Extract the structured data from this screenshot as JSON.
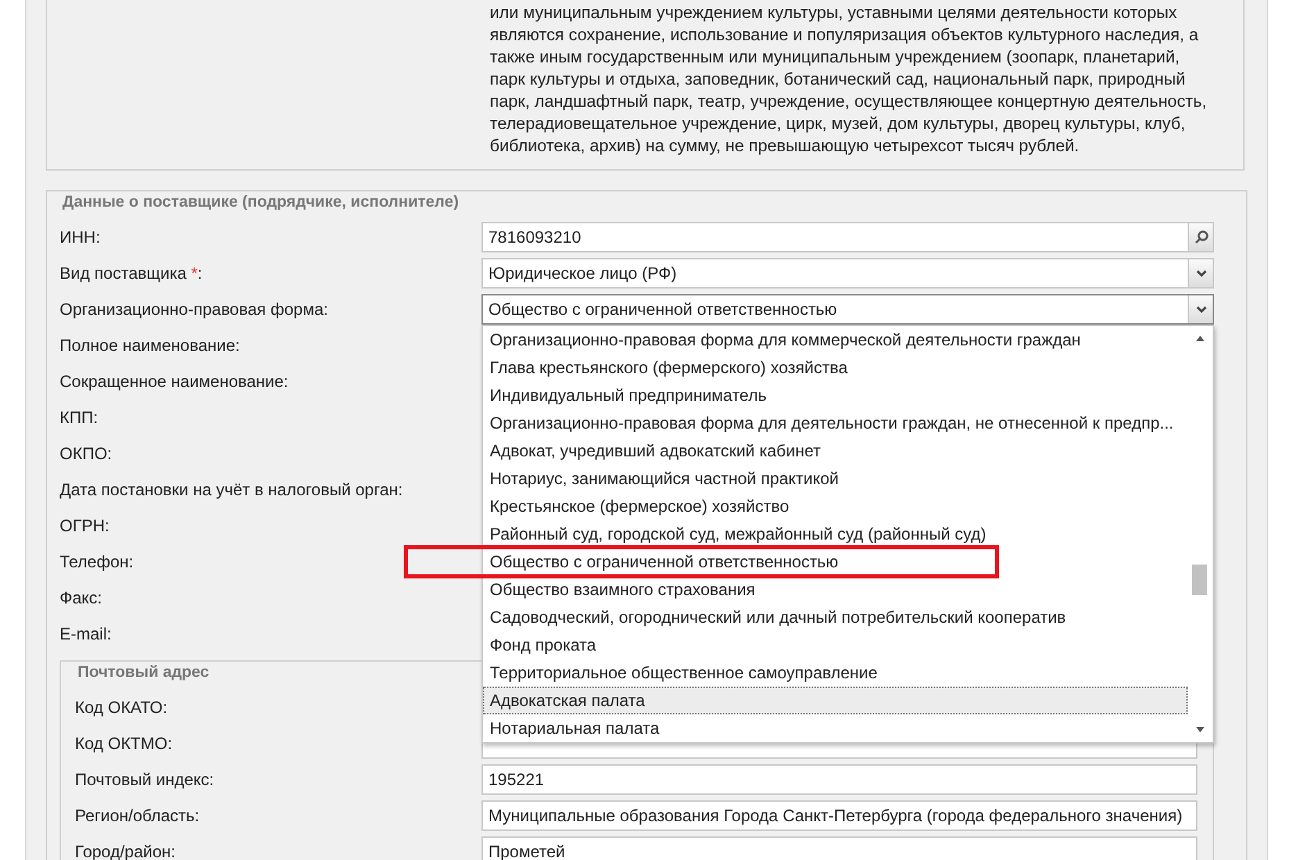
{
  "notice": {
    "text": "или муниципальным учреждением культуры, уставными целями деятельности которых являются сохранение, использование и популяризация объектов культурного наследия, а также иным государственным или муниципальным учреждением (зоопарк, планетарий, парк культуры и отдыха, заповедник, ботанический сад, национальный парк, природный парк, ландшафтный парк, театр, учреждение, осуществляющее концертную деятельность, телерадиовещательное учреждение, цирк, музей, дом культуры, дворец культуры, клуб, библиотека, архив) на сумму, не превышающую четырехсот тысяч рублей."
  },
  "supplier": {
    "legend": "Данные о поставщике (подрядчике, исполнителе)",
    "fields": [
      {
        "label": "ИНН:",
        "kind": "search",
        "value": "7816093210"
      },
      {
        "label": "Вид поставщика",
        "required_mark": "*",
        "suffix": ":",
        "kind": "select",
        "value": "Юридическое лицо (РФ)",
        "open": false
      },
      {
        "label": "Организационно-правовая форма:",
        "kind": "select",
        "value": "Общество с ограниченной ответственностью",
        "open": true
      },
      {
        "label": "Полное наименование:",
        "kind": "text"
      },
      {
        "label": "Сокращенное наименование:",
        "kind": "text"
      },
      {
        "label": "КПП:",
        "kind": "text"
      },
      {
        "label": "ОКПО:",
        "kind": "text"
      },
      {
        "label": "Дата постановки на учёт в налоговый орган:",
        "kind": "text"
      },
      {
        "label": "ОГРН:",
        "kind": "text"
      },
      {
        "label": "Телефон:",
        "kind": "text"
      },
      {
        "label": "Факс:",
        "kind": "text"
      },
      {
        "label": "E-mail:",
        "kind": "text"
      }
    ],
    "dropdown": [
      {
        "text": "Организационно-правовая форма для коммерческой деятельности граждан",
        "hovered": false,
        "highlighted": false
      },
      {
        "text": "Глава крестьянского (фермерского) хозяйства",
        "hovered": false,
        "highlighted": false
      },
      {
        "text": "Индивидуальный предприниматель",
        "hovered": false,
        "highlighted": false
      },
      {
        "text": "Организационно-правовая форма для деятельности граждан, не отнесенной к предпр...",
        "hovered": false,
        "highlighted": false
      },
      {
        "text": "Адвокат, учредивший адвокатский кабинет",
        "hovered": false,
        "highlighted": false
      },
      {
        "text": "Нотариус, занимающийся частной практикой",
        "hovered": false,
        "highlighted": false
      },
      {
        "text": "Крестьянское (фермерское) хозяйство",
        "hovered": false,
        "highlighted": false
      },
      {
        "text": "Районный суд, городской суд, межрайонный суд (районный суд)",
        "hovered": false,
        "highlighted": false
      },
      {
        "text": "Общество с ограниченной ответственностью",
        "hovered": false,
        "highlighted": true
      },
      {
        "text": "Общество взаимного страхования",
        "hovered": false,
        "highlighted": false
      },
      {
        "text": "Садоводческий, огороднический или дачный потребительский кооператив",
        "hovered": false,
        "highlighted": false
      },
      {
        "text": "Фонд проката",
        "hovered": false,
        "highlighted": false
      },
      {
        "text": "Территориальное общественное самоуправление",
        "hovered": false,
        "highlighted": false
      },
      {
        "text": "Адвокатская палата",
        "hovered": true,
        "highlighted": false
      },
      {
        "text": "Нотариальная палата",
        "hovered": false,
        "highlighted": false
      }
    ]
  },
  "postal": {
    "legend": "Почтовый адрес",
    "fields": [
      {
        "label": "Код ОКАТО:"
      },
      {
        "label": "Код ОКТМО:"
      },
      {
        "label": "Почтовый индекс:",
        "value": "195221"
      },
      {
        "label": "Регион/область:",
        "value": "Муниципальные образования Города Санкт-Петербурга (города федерального значения)"
      },
      {
        "label": "Город/район:",
        "value": "Прометей"
      }
    ]
  }
}
